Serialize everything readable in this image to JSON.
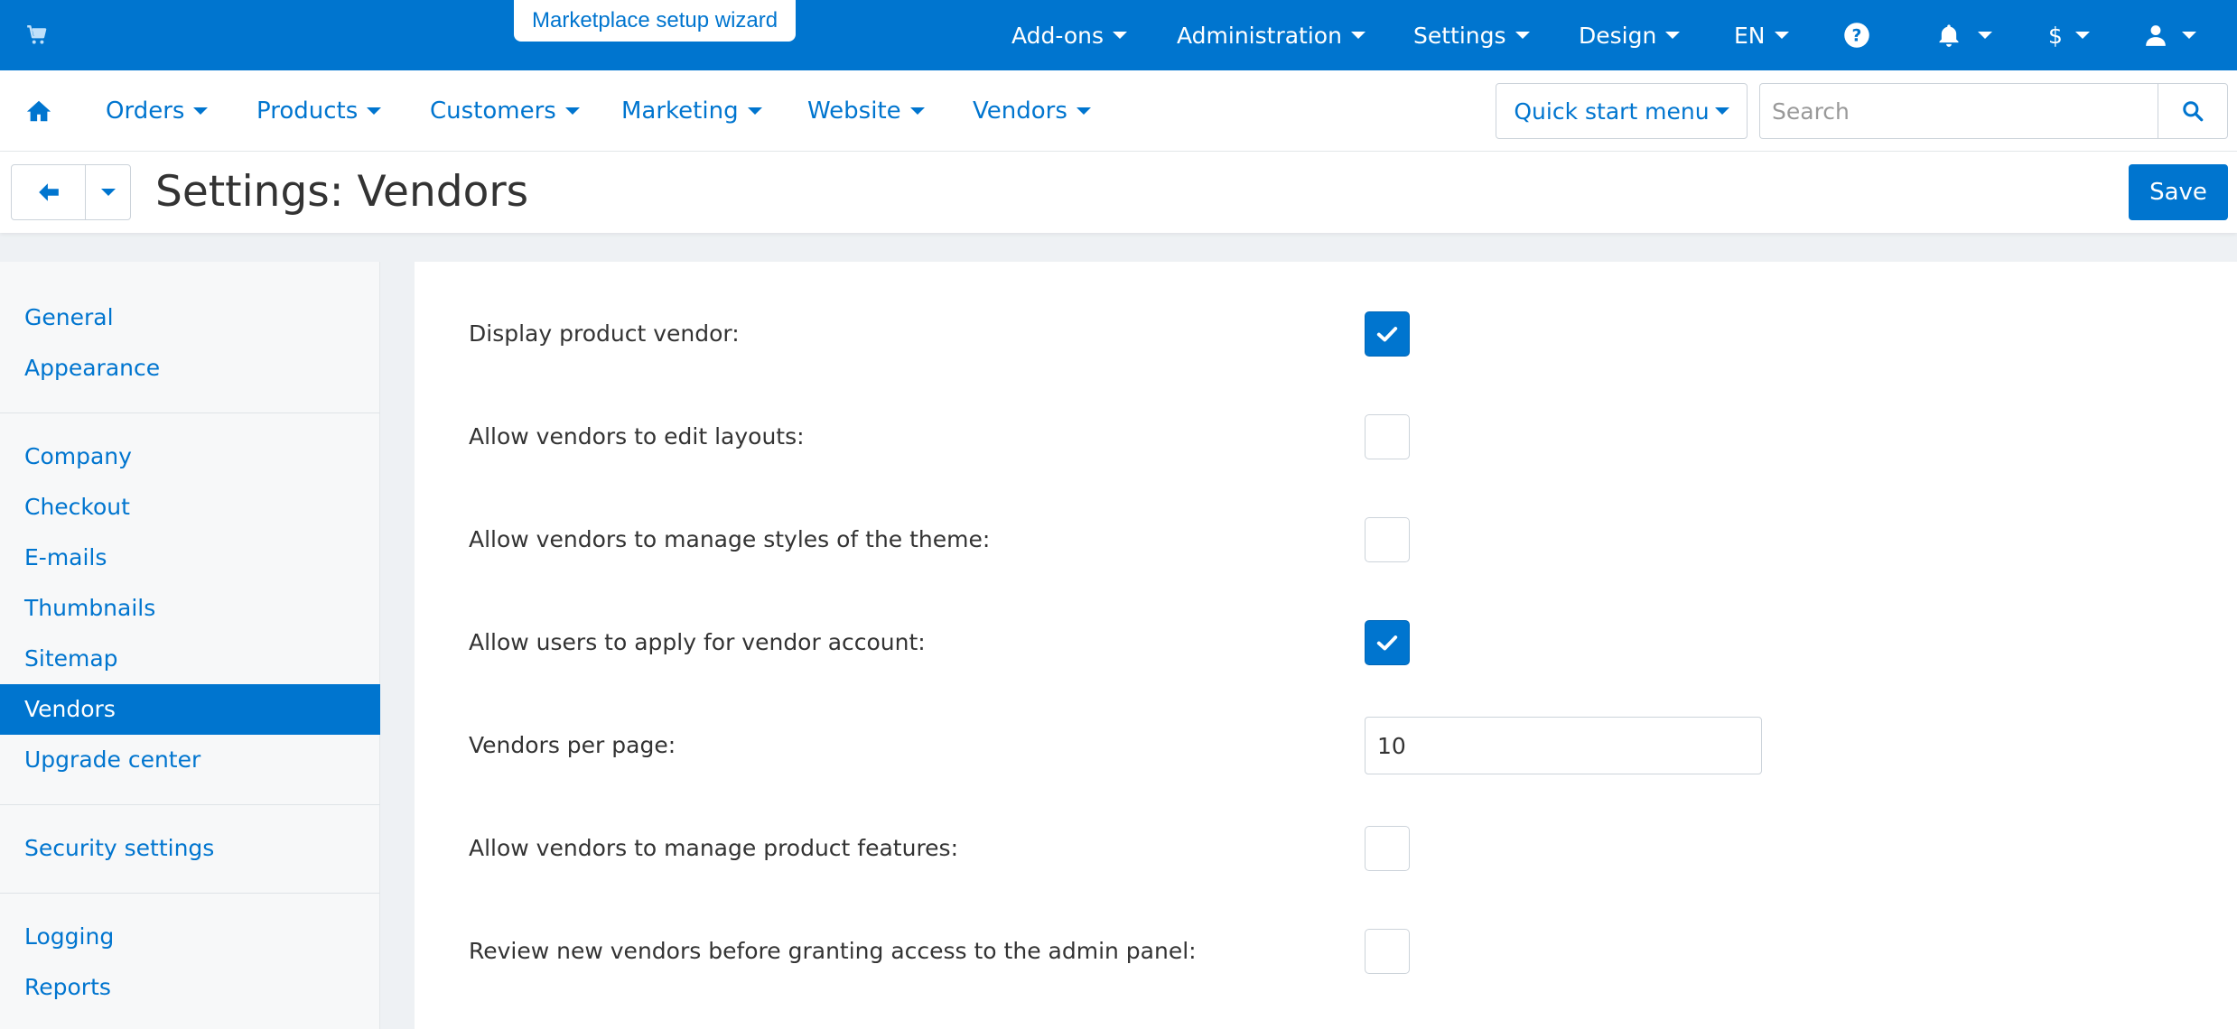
{
  "topbar": {
    "wizard_label": "Marketplace setup wizard",
    "nav": [
      {
        "label": "Add-ons"
      },
      {
        "label": "Administration"
      },
      {
        "label": "Settings"
      },
      {
        "label": "Design"
      },
      {
        "label": "EN"
      },
      {
        "label": "$"
      }
    ],
    "icons": [
      "cart-icon",
      "help-icon",
      "bell-icon",
      "user-icon"
    ],
    "background_color": "#0075cf"
  },
  "subnav": {
    "items": [
      {
        "label": "Orders"
      },
      {
        "label": "Products"
      },
      {
        "label": "Customers"
      },
      {
        "label": "Marketing"
      },
      {
        "label": "Website"
      },
      {
        "label": "Vendors"
      }
    ],
    "quick_start_label": "Quick start menu",
    "search_placeholder": "Search"
  },
  "titlebar": {
    "title": "Settings: Vendors",
    "save_label": "Save"
  },
  "sidebar": {
    "groups": [
      {
        "items": [
          {
            "label": "General"
          },
          {
            "label": "Appearance"
          }
        ]
      },
      {
        "items": [
          {
            "label": "Company"
          },
          {
            "label": "Checkout"
          },
          {
            "label": "E-mails"
          },
          {
            "label": "Thumbnails"
          },
          {
            "label": "Sitemap"
          },
          {
            "label": "Vendors",
            "active": true
          },
          {
            "label": "Upgrade center"
          }
        ]
      },
      {
        "items": [
          {
            "label": "Security settings"
          }
        ]
      },
      {
        "items": [
          {
            "label": "Logging"
          },
          {
            "label": "Reports"
          }
        ]
      }
    ]
  },
  "settings": [
    {
      "label": "Display product vendor:",
      "type": "checkbox",
      "checked": true
    },
    {
      "label": "Allow vendors to edit layouts:",
      "type": "checkbox",
      "checked": false
    },
    {
      "label": "Allow vendors to manage styles of the theme:",
      "type": "checkbox",
      "checked": false
    },
    {
      "label": "Allow users to apply for vendor account:",
      "type": "checkbox",
      "checked": true
    },
    {
      "label": "Vendors per page:",
      "type": "number",
      "value": "10"
    },
    {
      "label": "Allow vendors to manage product features:",
      "type": "checkbox",
      "checked": false
    },
    {
      "label": "Review new vendors before granting access to the admin panel:",
      "type": "checkbox",
      "checked": false
    }
  ]
}
